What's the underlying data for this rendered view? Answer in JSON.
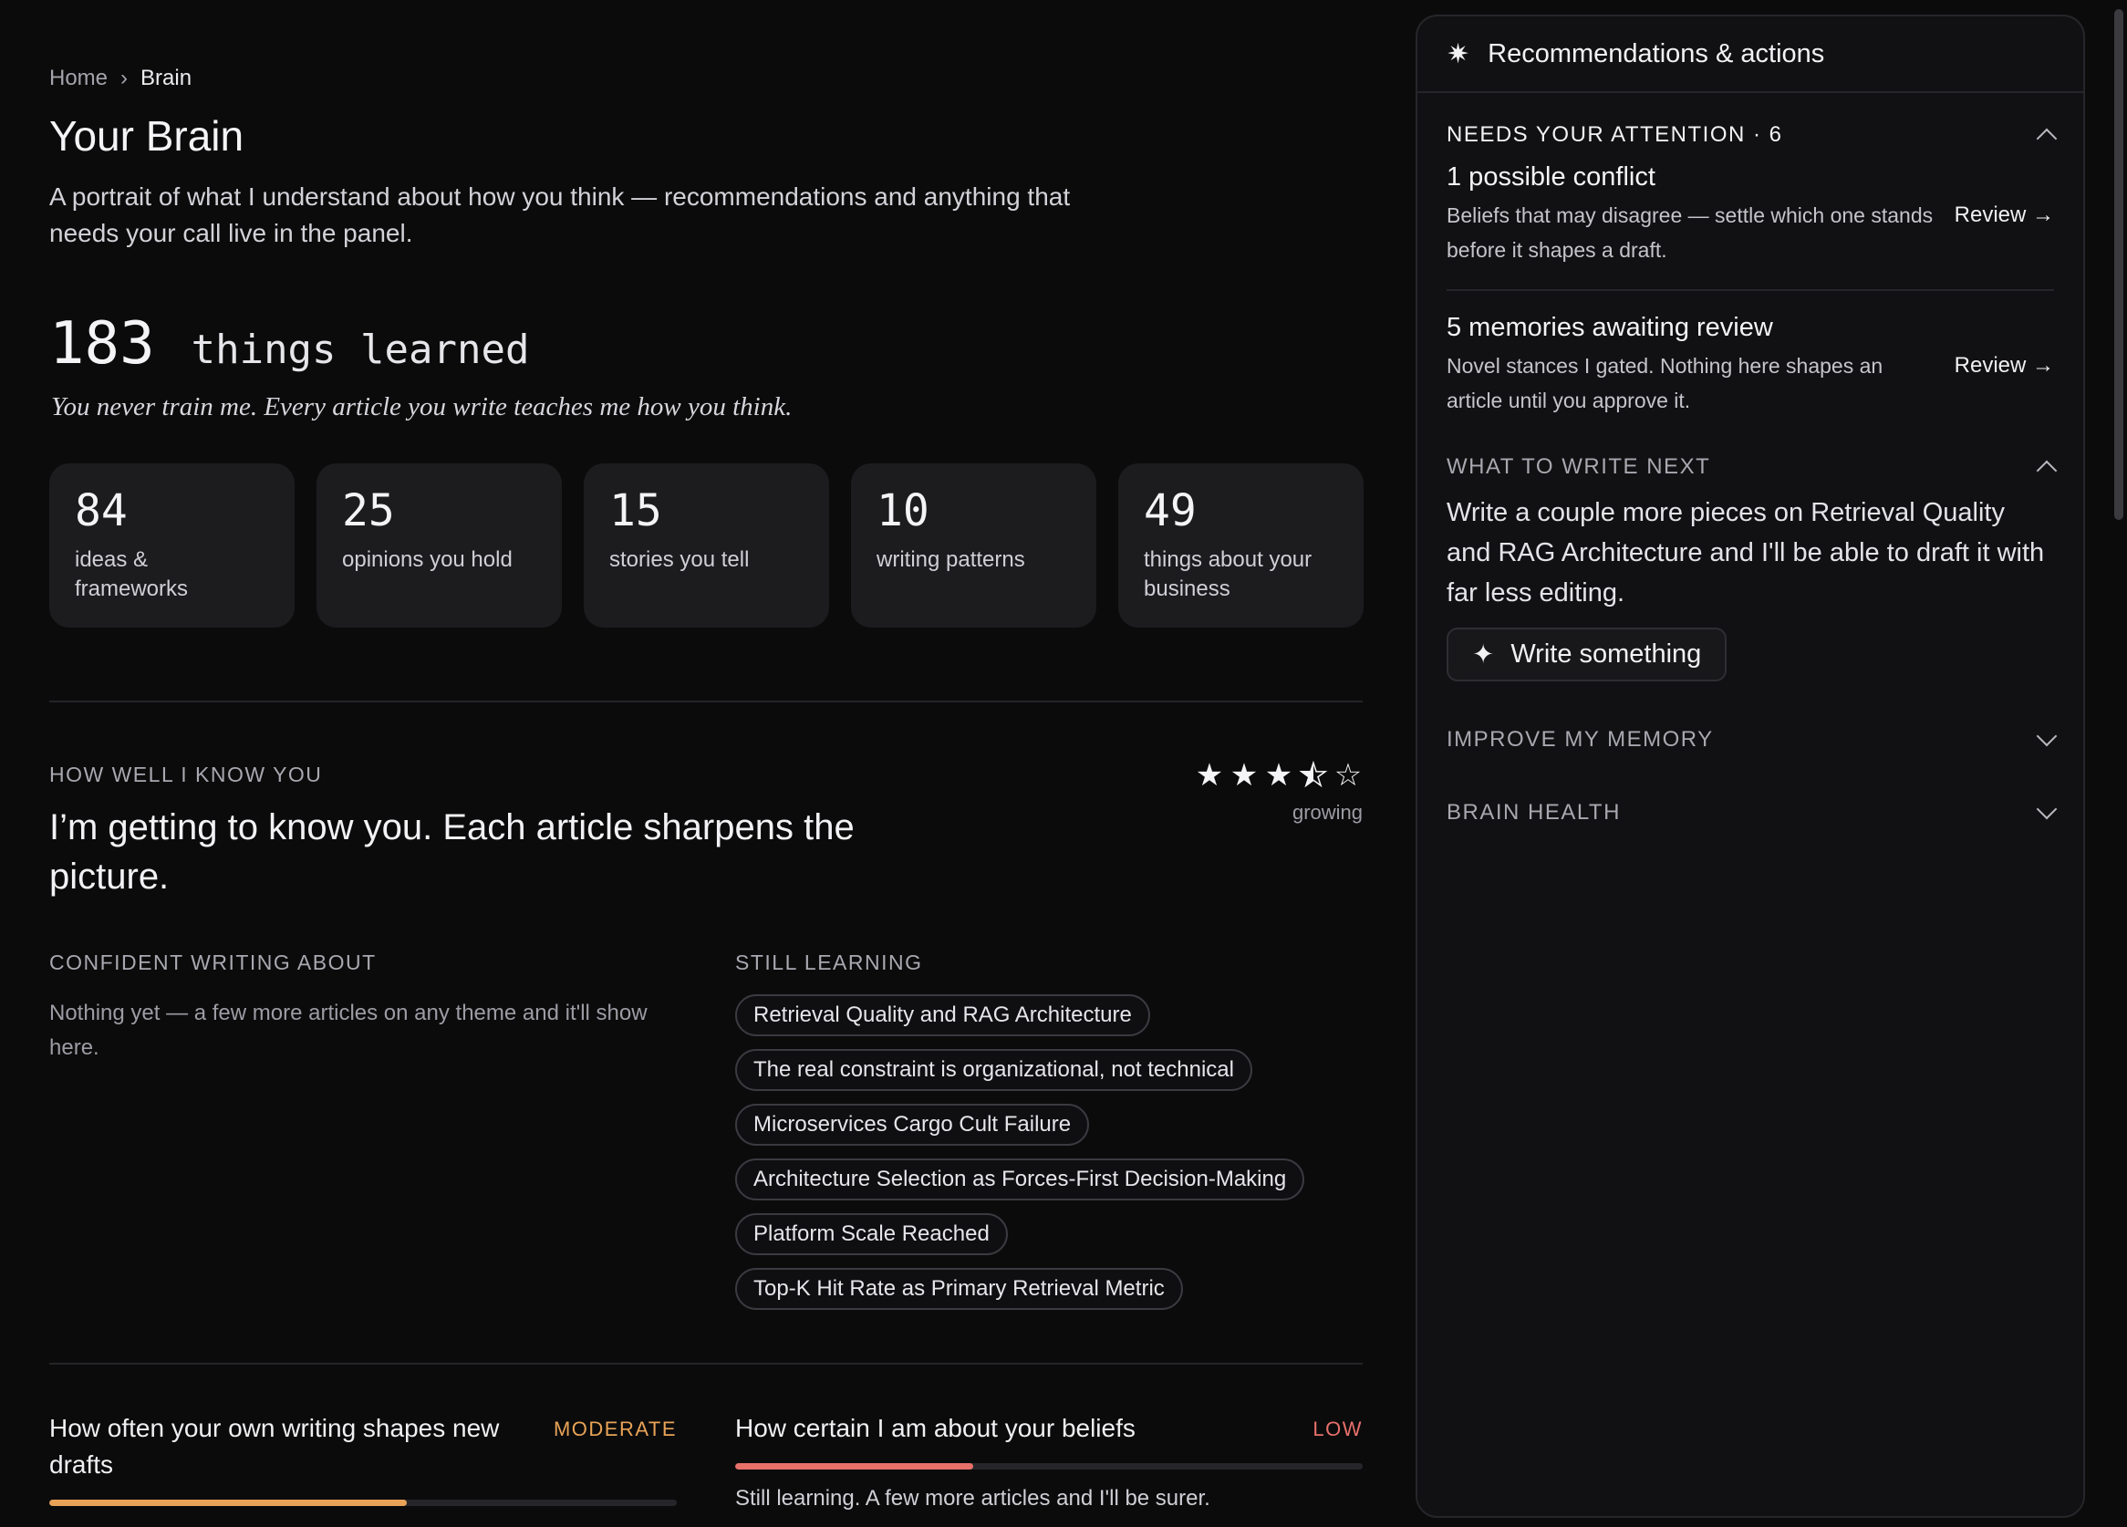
{
  "breadcrumb": {
    "home": "Home",
    "sep": "›",
    "current": "Brain"
  },
  "title": "Your Brain",
  "subtitle": "A portrait of what I understand about how you think — recommendations and anything that needs your call live in the panel.",
  "learned": {
    "count": "183",
    "label": "things learned"
  },
  "quote": "You never train me. Every article you write teaches me how you think.",
  "stats": [
    {
      "value": "84",
      "label": "ideas & frameworks"
    },
    {
      "value": "25",
      "label": "opinions you hold"
    },
    {
      "value": "15",
      "label": "stories you tell"
    },
    {
      "value": "10",
      "label": "writing patterns"
    },
    {
      "value": "49",
      "label": "things about your business"
    }
  ],
  "know": {
    "label": "HOW WELL I KNOW YOU",
    "headline": "I’m getting to know you. Each article sharpens the picture.",
    "rating": 3.5,
    "rating_max": 5,
    "rating_label": "growing"
  },
  "confident": {
    "label": "CONFIDENT WRITING ABOUT",
    "empty_text": "Nothing yet — a few more articles on any theme and it'll show here."
  },
  "still_learning": {
    "label": "STILL LEARNING",
    "topics": [
      "Retrieval Quality and RAG Architecture",
      "The real constraint is organizational, not technical",
      "Microservices Cargo Cult Failure",
      "Architecture Selection as Forces-First Decision-Making",
      "Platform Scale Reached",
      "Top-K Hit Rate as Primary Retrieval Metric"
    ]
  },
  "meters": {
    "writing": {
      "question": "How often your own writing shapes new drafts",
      "level": "MODERATE",
      "fraction": 0.57,
      "color": "#e8a356"
    },
    "certainty": {
      "question": "How certain I am about your beliefs",
      "level": "LOW",
      "fraction": 0.38,
      "color": "#e8706a",
      "note": "Still learning. A few more articles and I'll be surer."
    }
  },
  "panel": {
    "title": "Recommendations & actions",
    "attention": {
      "label": "NEEDS YOUR ATTENTION · 6",
      "items": [
        {
          "title": "1 possible conflict",
          "desc": "Beliefs that may disagree — settle which one stands before it shapes a draft.",
          "action": "Review →"
        },
        {
          "title": "5 memories awaiting review",
          "desc": "Novel stances I gated. Nothing here shapes an article until you approve it.",
          "action": "Review →"
        }
      ]
    },
    "next": {
      "label": "WHAT TO WRITE NEXT",
      "text": "Write a couple more pieces on Retrieval Quality and RAG Architecture and I'll be able to draft it with far less editing.",
      "button": "Write something"
    },
    "improve_label": "IMPROVE MY MEMORY",
    "health_label": "BRAIN HEALTH"
  }
}
